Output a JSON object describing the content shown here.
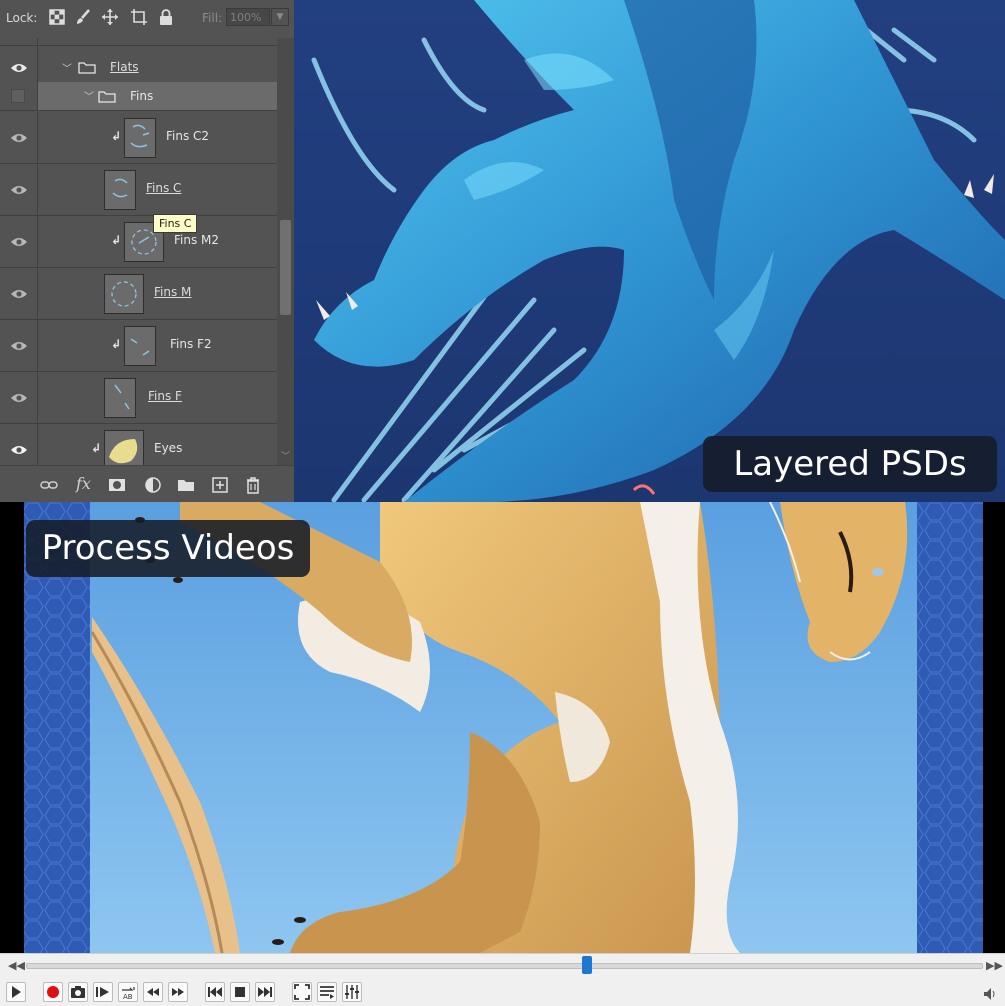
{
  "layers_panel": {
    "lock_label": "Lock:",
    "fill_label": "Fill:",
    "fill_value": "100%",
    "tooltip": "Fins C",
    "rows": [
      {
        "name": "Flats",
        "kind": "group",
        "visible": true,
        "underlined": true
      },
      {
        "name": "Fins",
        "kind": "group",
        "visible": false,
        "selected": true
      },
      {
        "name": "Fins C2",
        "kind": "layer",
        "visible": true,
        "clipped": true
      },
      {
        "name": "Fins C",
        "kind": "layer",
        "visible": true,
        "underlined": true
      },
      {
        "name": "Fins M2",
        "kind": "layer",
        "visible": true,
        "clipped": true
      },
      {
        "name": "Fins M",
        "kind": "layer",
        "visible": true,
        "underlined": true
      },
      {
        "name": "Fins F2",
        "kind": "layer",
        "visible": true,
        "clipped": true
      },
      {
        "name": "Fins F",
        "kind": "layer",
        "visible": true,
        "underlined": true
      },
      {
        "name": "Eyes",
        "kind": "layer",
        "visible": true,
        "clipped": true
      }
    ],
    "footer_icons": [
      "link-icon",
      "fx-icon",
      "mask-icon",
      "adjustment-icon",
      "folder-icon",
      "new-layer-icon",
      "trash-icon"
    ]
  },
  "captions": {
    "top": "Layered PSDs",
    "bottom": "Process Videos"
  },
  "player": {
    "seek_position": 0.585,
    "buttons": [
      "play",
      "record",
      "snapshot",
      "frame-step",
      "loop-ab",
      "slower",
      "faster",
      "previous",
      "stop",
      "next",
      "fullscreen",
      "playlist",
      "extended-settings"
    ]
  },
  "colors": {
    "ps_bg": "#535353",
    "art_blue_bg": "#1f3d7a",
    "dragon_blue": "#37a0dc",
    "video_sky": "#6aaee6",
    "creature_tan": "#e3b468",
    "seek_accent": "#1f78d0"
  }
}
